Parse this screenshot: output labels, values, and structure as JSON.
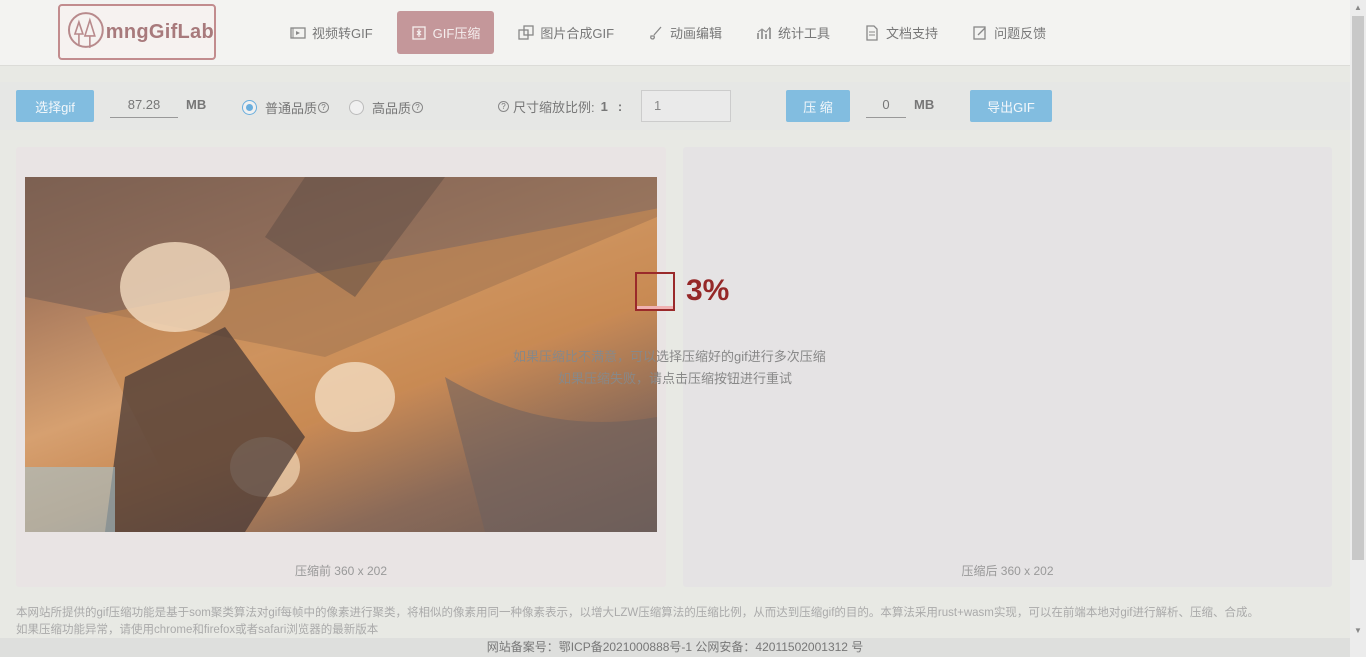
{
  "logo": {
    "text": "mngGifLab",
    "icon": "tree-icon"
  },
  "nav": [
    {
      "label": "视频转GIF",
      "icon": "video-icon",
      "active": false
    },
    {
      "label": "GIF压缩",
      "icon": "compress-icon",
      "active": true
    },
    {
      "label": "图片合成GIF",
      "icon": "images-icon",
      "active": false
    },
    {
      "label": "动画编辑",
      "icon": "brush-icon",
      "active": false
    },
    {
      "label": "统计工具",
      "icon": "chart-icon",
      "active": false
    },
    {
      "label": "文档支持",
      "icon": "document-icon",
      "active": false
    },
    {
      "label": "问题反馈",
      "icon": "feedback-icon",
      "active": false
    }
  ],
  "toolbar": {
    "select_label": "选择gif",
    "input_size": "87.28",
    "unit": "MB",
    "quality_normal": "普通品质",
    "quality_high": "高品质",
    "quality_selected": "normal",
    "scale_label": "尺寸缩放比例:",
    "scale_prefix": "1",
    "scale_colon": ":",
    "scale_value": "1",
    "compress_label": "压 缩",
    "output_size": "0",
    "export_label": "导出GIF"
  },
  "panels": {
    "before_caption": "压缩前 360 x 202",
    "after_caption": "压缩后 360 x 202"
  },
  "progress": {
    "percent_text": "3%",
    "value": 0.03
  },
  "hints": {
    "line1": "如果压缩比不满意，可以选择压缩好的gif进行多次压缩",
    "line2": "如果压缩失败，请点击压缩按钮进行重试"
  },
  "notes": {
    "line1": "本网站所提供的gif压缩功能是基于som聚类算法对gif每帧中的像素进行聚类，将相似的像素用同一种像素表示，以增大LZW压缩算法的压缩比例，从而达到压缩gif的目的。本算法采用rust+wasm实现，可以在前端本地对gif进行解析、压缩、合成。",
    "line2": "如果压缩功能异常，请使用chrome和firefox或者safari浏览器的最新版本"
  },
  "footer": "网站备案号：鄂ICP备2021000888号-1 公网安备：42011502001312 号"
}
